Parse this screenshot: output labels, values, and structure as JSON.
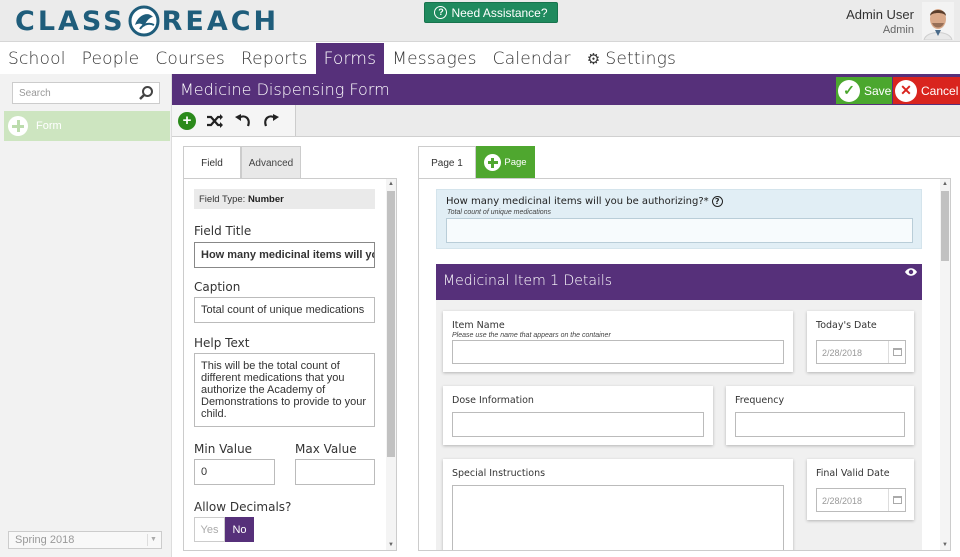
{
  "header": {
    "logo_left": "CLASS",
    "logo_right": "REACH",
    "assist_label": "Need Assistance?",
    "user_name": "Admin User",
    "user_role": "Admin"
  },
  "nav": {
    "items": [
      "School",
      "People",
      "Courses",
      "Reports",
      "Forms",
      "Messages",
      "Calendar",
      "Settings"
    ],
    "active": "Forms"
  },
  "sidebar": {
    "search_placeholder": "Search",
    "form_item": "Form",
    "term": "Spring 2018"
  },
  "form": {
    "title": "Medicine Dispensing Form",
    "save_label": "Save",
    "cancel_label": "Cancel"
  },
  "field_panel": {
    "tabs": [
      "Field",
      "Advanced"
    ],
    "active_tab": "Field",
    "field_type_label": "Field Type:",
    "field_type_value": "Number",
    "field_title_label": "Field Title",
    "field_title_value": "How many medicinal items will yo",
    "caption_label": "Caption",
    "caption_value": "Total count of unique medications",
    "help_label": "Help Text",
    "help_value": "This will be the total count of different medications that you authorize the Academy of Demonstrations to provide to your child.",
    "min_label": "Min Value",
    "min_value": "0",
    "max_label": "Max Value",
    "max_value": "",
    "decimals_label": "Allow Decimals?",
    "yes_label": "Yes",
    "no_label": "No",
    "decimals_selected": "No"
  },
  "canvas": {
    "page_tab": "Page 1",
    "add_page_label": "Page",
    "question": {
      "title": "How many medicinal items will you be authorizing?*",
      "caption": "Total count of unique medications"
    },
    "section": {
      "title": "Medicinal Item 1 Details",
      "fields": {
        "item_name_label": "Item Name",
        "item_name_caption": "Please use the name that appears on the container",
        "todays_date_label": "Today's Date",
        "todays_date_value": "2/28/2018",
        "dose_label": "Dose Information",
        "frequency_label": "Frequency",
        "special_label": "Special Instructions",
        "final_date_label": "Final Valid Date",
        "final_date_value": "2/28/2018"
      }
    }
  },
  "colors": {
    "brand_purple": "#56307a",
    "green": "#4ba72e",
    "red": "#d9241e",
    "logo_blue": "#1f5d7b"
  }
}
